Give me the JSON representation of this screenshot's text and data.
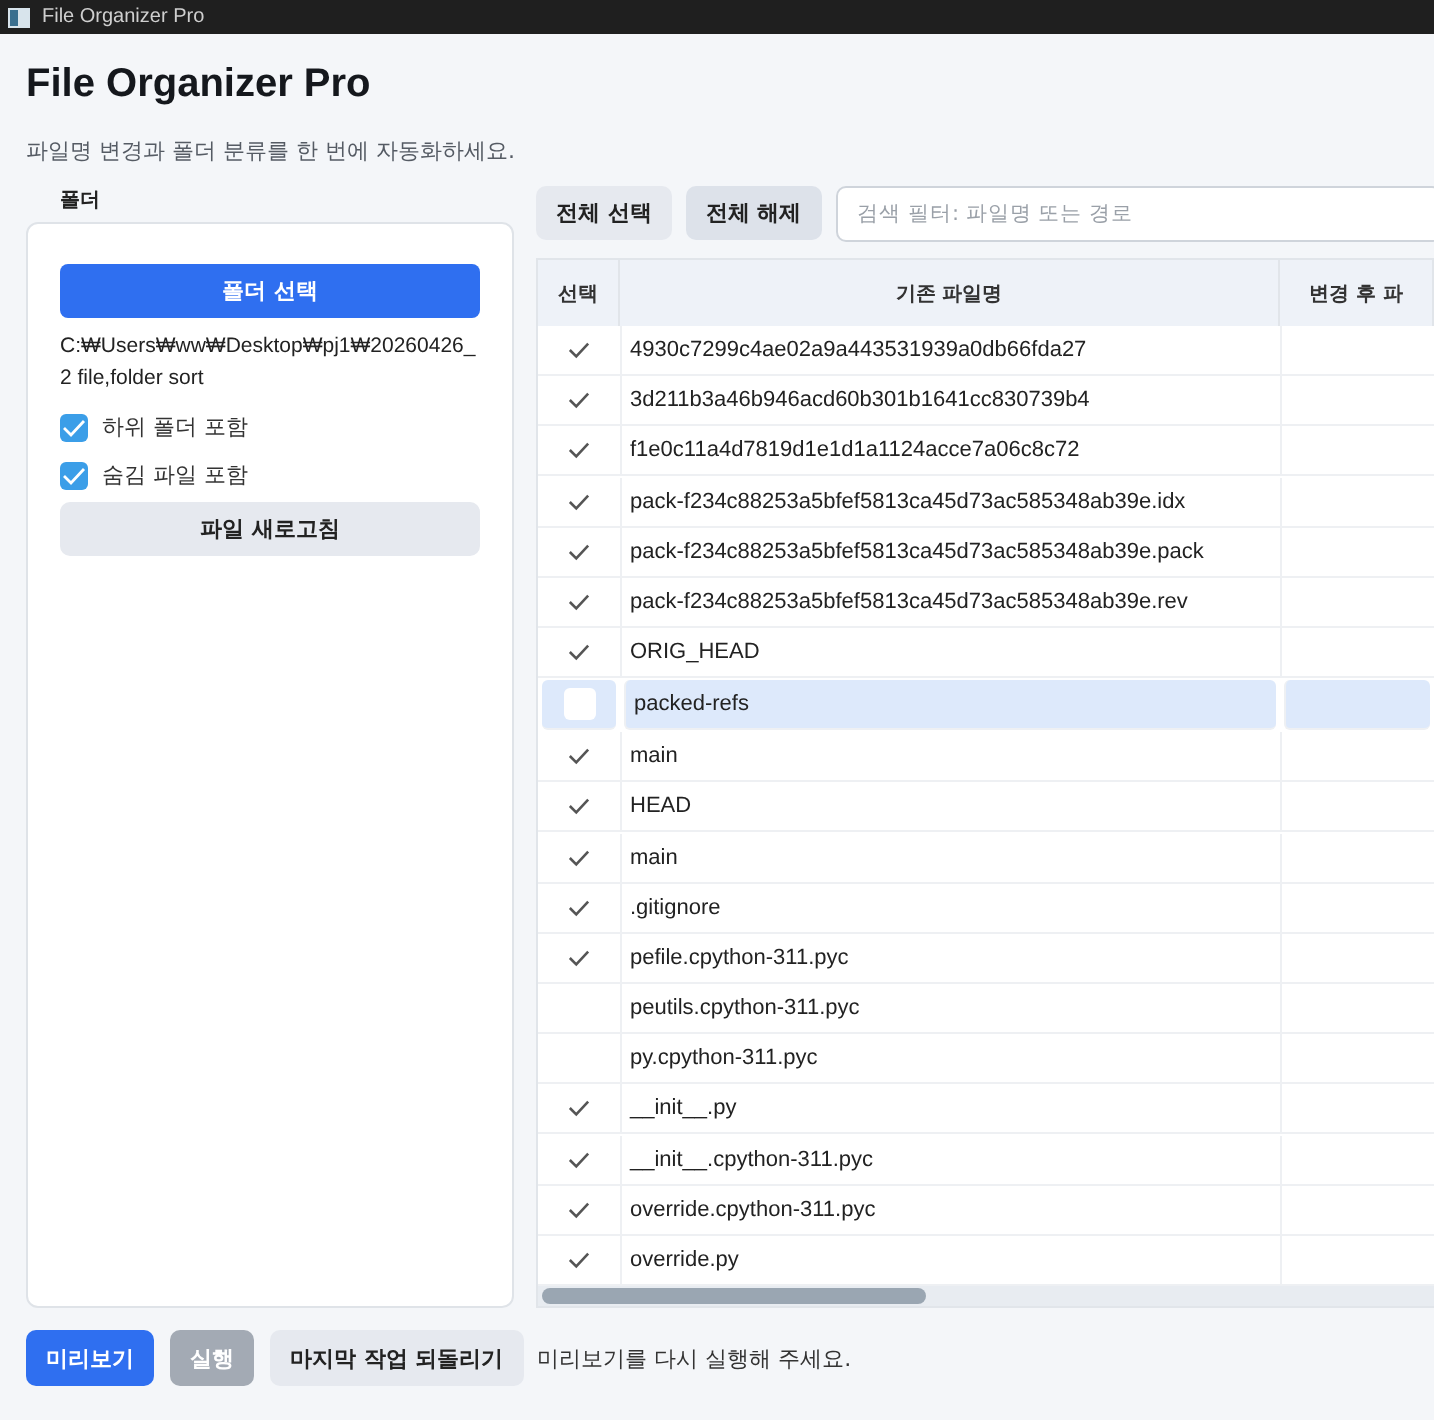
{
  "window": {
    "title": "File Organizer Pro"
  },
  "header": {
    "title": "File Organizer Pro",
    "subtitle": "파일명 변경과 폴더 분류를 한 번에 자동화하세요."
  },
  "folder_panel": {
    "label": "폴더",
    "choose_button": "폴더 선택",
    "path": "C:₩Users₩ww₩Desktop₩pj1₩20260426_2 file,folder sort",
    "options": [
      {
        "label": "하위 폴더 포함",
        "checked": true
      },
      {
        "label": "숨김 파일 포함",
        "checked": true
      }
    ],
    "refresh_button": "파일 새로고침"
  },
  "toolbar": {
    "buttons": [
      "전체 선택",
      "전체 해제"
    ],
    "search": {
      "placeholder": "검색 필터: 파일명 또는 경로"
    }
  },
  "table": {
    "columns": [
      "선택",
      "기존 파일명",
      "변경 후 파"
    ],
    "rows": [
      {
        "name": "4930c7299c4ae02a9a443531939a0db66fda27",
        "checked": true,
        "selected": false
      },
      {
        "name": "3d211b3a46b946acd60b301b1641cc830739b4",
        "checked": true,
        "selected": false
      },
      {
        "name": "f1e0c11a4d7819d1e1d1a1124acce7a06c8c72",
        "checked": true,
        "selected": false
      },
      {
        "name": "pack-f234c88253a5bfef5813ca45d73ac585348ab39e.idx",
        "checked": true,
        "selected": false
      },
      {
        "name": "pack-f234c88253a5bfef5813ca45d73ac585348ab39e.pack",
        "checked": true,
        "selected": false
      },
      {
        "name": "pack-f234c88253a5bfef5813ca45d73ac585348ab39e.rev",
        "checked": true,
        "selected": false
      },
      {
        "name": "ORIG_HEAD",
        "checked": true,
        "selected": false
      },
      {
        "name": "packed-refs",
        "checked": false,
        "selected": true
      },
      {
        "name": "main",
        "checked": true,
        "selected": false
      },
      {
        "name": "HEAD",
        "checked": true,
        "selected": false
      },
      {
        "name": "main",
        "checked": true,
        "selected": false
      },
      {
        "name": ".gitignore",
        "checked": true,
        "selected": false
      },
      {
        "name": "pefile.cpython-311.pyc",
        "checked": true,
        "selected": false
      },
      {
        "name": "peutils.cpython-311.pyc",
        "checked": false,
        "selected": false
      },
      {
        "name": "py.cpython-311.pyc",
        "checked": false,
        "selected": false
      },
      {
        "name": "__init__.py",
        "checked": true,
        "selected": false
      },
      {
        "name": "__init__.cpython-311.pyc",
        "checked": true,
        "selected": false
      },
      {
        "name": "override.cpython-311.pyc",
        "checked": true,
        "selected": false
      },
      {
        "name": "override.py",
        "checked": true,
        "selected": false
      }
    ]
  },
  "actions": {
    "preview_button": {
      "label": "미리보기",
      "disabled": false
    },
    "run_button": {
      "label": "실행",
      "disabled": true
    },
    "undo_button": {
      "label": "마지막 작업 되돌리기",
      "disabled": false
    },
    "status": "미리보기를 다시 실행해 주세요."
  }
}
